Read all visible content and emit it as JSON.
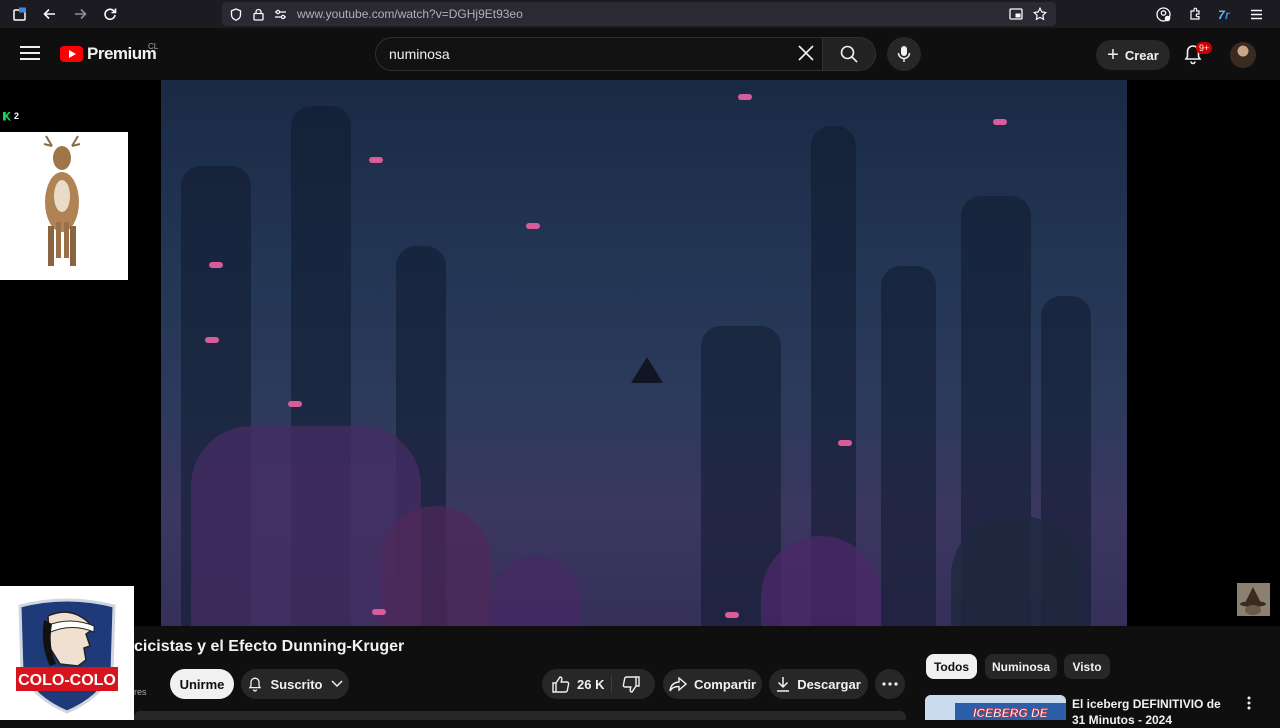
{
  "browser": {
    "url": "www.youtube.com/watch?v=DGHj9Et93eo"
  },
  "header": {
    "logo_text": "Premium",
    "country_code": "CL",
    "search_value": "numinosa",
    "create_label": "Crear",
    "notification_badge": "9+"
  },
  "side": {
    "k_count": "2",
    "colo_colo_text": "COLO-COLO"
  },
  "video": {
    "title": "cicistas y el Efecto Dunning-Kruger",
    "channel_sub": "res"
  },
  "actions": {
    "join_label": "Unirme",
    "subscribed_label": "Suscrito",
    "likes": "26 K",
    "share_label": "Compartir",
    "download_label": "Descargar"
  },
  "filters": [
    {
      "label": "Todos",
      "active": true
    },
    {
      "label": "Numinosa",
      "active": false
    },
    {
      "label": "Visto",
      "active": false
    }
  ],
  "recommendation": {
    "title": "El iceberg DEFINITIVIO de 31 Minutos - 2024",
    "thumb_text": "ICEBERG DE"
  }
}
